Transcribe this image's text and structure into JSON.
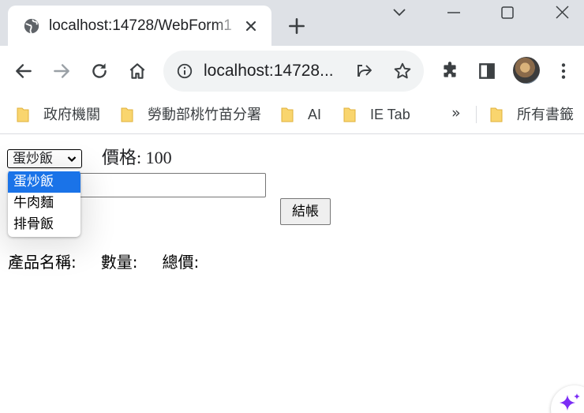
{
  "browser": {
    "tab": {
      "title": "localhost:14728/WebForm1"
    },
    "address_bar": {
      "url": "localhost:14728..."
    },
    "bookmarks": [
      {
        "label": "政府機關"
      },
      {
        "label": "勞動部桃竹苗分署"
      },
      {
        "label": "AI"
      },
      {
        "label": "IE Tab"
      }
    ],
    "bookmarks_more": "»",
    "all_bookmarks": {
      "label": "所有書籤"
    }
  },
  "page": {
    "product_select": {
      "selected": "蛋炒飯",
      "options": [
        "蛋炒飯",
        "牛肉麵",
        "排骨飯"
      ]
    },
    "price": "價格: 100",
    "checkout_button": "結帳",
    "result_labels": {
      "product_name": "產品名稱:",
      "quantity": "數量:",
      "total": "總價:"
    }
  },
  "colors": {
    "tabstrip": "#dee1e6",
    "selected_option": "#1a73e8",
    "sparkle": "#7b2cf5"
  }
}
